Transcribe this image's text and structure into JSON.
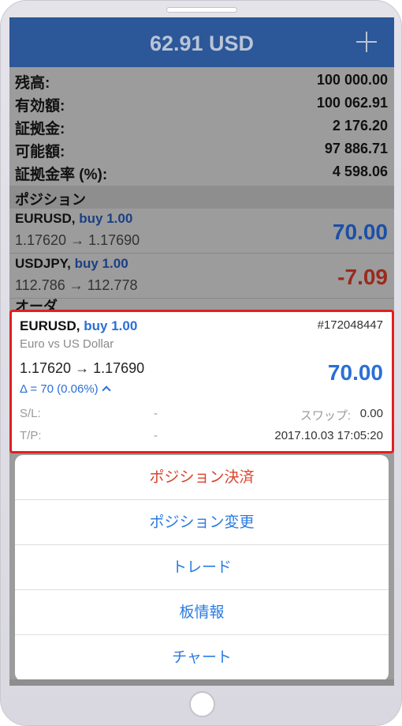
{
  "header": {
    "title": "62.91 USD"
  },
  "summary": [
    {
      "label": "残高:",
      "value": "100 000.00"
    },
    {
      "label": "有効額:",
      "value": "100 062.91"
    },
    {
      "label": "証拠金:",
      "value": "2 176.20"
    },
    {
      "label": "可能額:",
      "value": "97 886.71"
    },
    {
      "label": "証拠金率 (%):",
      "value": "4 598.06"
    }
  ],
  "positions_section": {
    "title": "ポジション"
  },
  "positions": [
    {
      "symbol": "EURUSD,",
      "side": "buy 1.00",
      "prices": "1.17620 → 1.17690",
      "profit": "70.00",
      "profit_color": "#1b4fa8"
    },
    {
      "symbol": "USDJPY,",
      "side": "buy 1.00",
      "prices": "112.786 → 112.778",
      "profit": "-7.09",
      "profit_color": "#9a2a1c"
    }
  ],
  "orders_section": {
    "title": "オーダ"
  },
  "selected_position": {
    "symbol": "EURUSD,",
    "side": "buy 1.00",
    "ticket": "#172048447",
    "description": "Euro vs US Dollar",
    "prices": "1.17620 → 1.17690",
    "profit": "70.00",
    "delta": "Δ = 70 (0.06%)",
    "sl_label": "S/L:",
    "sl_value": "-",
    "swap_label": "スワップ:",
    "swap_value": "0.00",
    "tp_label": "T/P:",
    "tp_value": "-",
    "time": "2017.10.03 17:05:20"
  },
  "action_sheet": {
    "items": [
      {
        "label": "ポジション決済",
        "style": "destructive"
      },
      {
        "label": "ポジション変更",
        "style": "default"
      },
      {
        "label": "トレード",
        "style": "default"
      },
      {
        "label": "板情報",
        "style": "default"
      },
      {
        "label": "チャート",
        "style": "default"
      }
    ]
  },
  "colors": {
    "header_bg": "#2c5799",
    "accent_blue": "#2a7be0",
    "destructive_red": "#d8442c",
    "highlight_border": "#e02020"
  }
}
